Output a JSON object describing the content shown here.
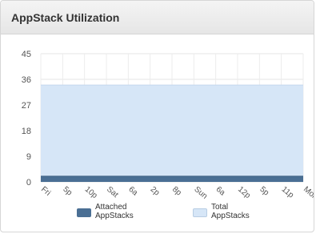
{
  "panel": {
    "title": "AppStack Utilization"
  },
  "chart_data": {
    "type": "area",
    "title": "",
    "xlabel": "",
    "ylabel": "",
    "ylim": [
      0,
      45
    ],
    "yticks": [
      0,
      9,
      18,
      27,
      36,
      45
    ],
    "categories": [
      "Fri",
      "5p",
      "10p",
      "Sat",
      "6a",
      "2p",
      "8p",
      "Sun",
      "6a",
      "12p",
      "5p",
      "11p",
      "Mon"
    ],
    "grid": true,
    "legend_position": "bottom",
    "series": [
      {
        "name": "Total AppStacks",
        "color": "#d6e6f7",
        "values": [
          34,
          34,
          34,
          34,
          34,
          34,
          34,
          34,
          34,
          34,
          34,
          34,
          34
        ]
      },
      {
        "name": "Attached AppStacks",
        "color": "#4a6f94",
        "values": [
          2,
          2,
          2,
          2,
          2,
          2,
          2,
          2,
          2,
          2,
          2,
          2,
          2
        ]
      }
    ]
  },
  "legend": {
    "attached": {
      "line1": "Attached",
      "line2": "AppStacks",
      "color": "#4a6f94"
    },
    "total": {
      "line1": "Total",
      "line2": "AppStacks",
      "color": "#d6e6f7"
    }
  }
}
